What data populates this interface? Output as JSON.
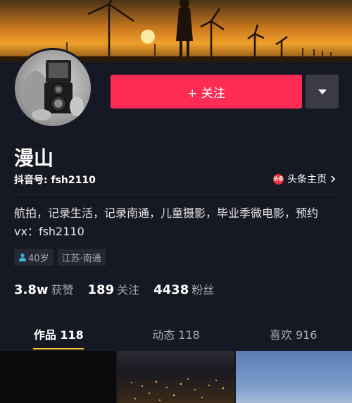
{
  "profile": {
    "name": "漫山",
    "douyin_id": "抖音号: fsh2110",
    "toutiao_logo": "头条",
    "toutiao_link": "头条主页",
    "bio": "航拍，记录生活，记录南通，儿童摄影，毕业季微电影，预约vx：fsh2110",
    "tags": {
      "age": "40岁",
      "location": "江苏·南通"
    }
  },
  "actions": {
    "follow_label": "+ 关注",
    "more_icon": "caret-down-icon"
  },
  "stats": {
    "likes_value": "3.8w",
    "likes_label": "获赞",
    "following_value": "189",
    "following_label": "关注",
    "followers_value": "4438",
    "followers_label": "粉丝"
  },
  "tabs": [
    {
      "label": "作品 118"
    },
    {
      "label": "动态 118"
    },
    {
      "label": "喜欢 916"
    }
  ],
  "colors": {
    "background": "#161823",
    "follow": "#fe2c55",
    "tab_indicator": "#fbc635",
    "toutiao_red": "#e8323c"
  }
}
